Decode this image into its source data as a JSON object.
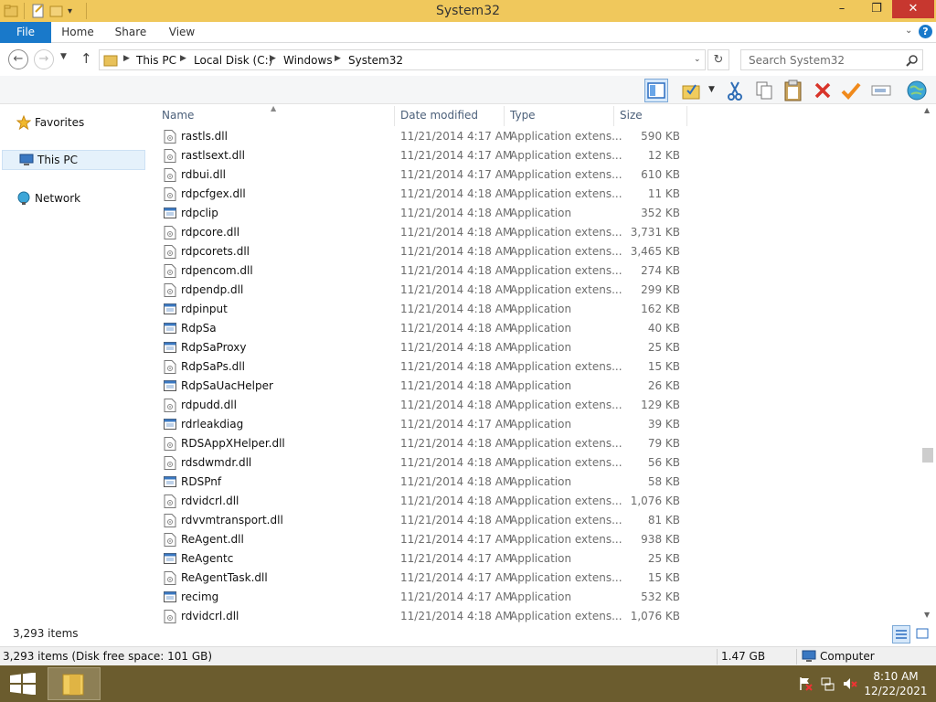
{
  "window": {
    "title": "System32",
    "minimize": "–",
    "maximize": "❐",
    "close": "✕"
  },
  "ribbon": {
    "tabs": [
      "File",
      "Home",
      "Share",
      "View"
    ],
    "help": "?"
  },
  "address": {
    "crumbs": [
      "This PC",
      "Local Disk (C:)",
      "Windows",
      "System32"
    ],
    "search_placeholder": "Search System32"
  },
  "nav_pane": {
    "items": [
      "Favorites",
      "This PC",
      "Network"
    ]
  },
  "columns": {
    "name": "Name",
    "date": "Date modified",
    "type": "Type",
    "size": "Size"
  },
  "files": [
    {
      "name": "rastls.dll",
      "date": "11/21/2014 4:17 AM",
      "type": "Application extens...",
      "size": "590 KB",
      "kind": "dll"
    },
    {
      "name": "rastlsext.dll",
      "date": "11/21/2014 4:17 AM",
      "type": "Application extens...",
      "size": "12 KB",
      "kind": "dll"
    },
    {
      "name": "rdbui.dll",
      "date": "11/21/2014 4:17 AM",
      "type": "Application extens...",
      "size": "610 KB",
      "kind": "dll"
    },
    {
      "name": "rdpcfgex.dll",
      "date": "11/21/2014 4:18 AM",
      "type": "Application extens...",
      "size": "11 KB",
      "kind": "dll"
    },
    {
      "name": "rdpclip",
      "date": "11/21/2014 4:18 AM",
      "type": "Application",
      "size": "352 KB",
      "kind": "exe"
    },
    {
      "name": "rdpcore.dll",
      "date": "11/21/2014 4:18 AM",
      "type": "Application extens...",
      "size": "3,731 KB",
      "kind": "dll"
    },
    {
      "name": "rdpcorets.dll",
      "date": "11/21/2014 4:18 AM",
      "type": "Application extens...",
      "size": "3,465 KB",
      "kind": "dll"
    },
    {
      "name": "rdpencom.dll",
      "date": "11/21/2014 4:18 AM",
      "type": "Application extens...",
      "size": "274 KB",
      "kind": "dll"
    },
    {
      "name": "rdpendp.dll",
      "date": "11/21/2014 4:18 AM",
      "type": "Application extens...",
      "size": "299 KB",
      "kind": "dll"
    },
    {
      "name": "rdpinput",
      "date": "11/21/2014 4:18 AM",
      "type": "Application",
      "size": "162 KB",
      "kind": "exe"
    },
    {
      "name": "RdpSa",
      "date": "11/21/2014 4:18 AM",
      "type": "Application",
      "size": "40 KB",
      "kind": "exe"
    },
    {
      "name": "RdpSaProxy",
      "date": "11/21/2014 4:18 AM",
      "type": "Application",
      "size": "25 KB",
      "kind": "exe"
    },
    {
      "name": "RdpSaPs.dll",
      "date": "11/21/2014 4:18 AM",
      "type": "Application extens...",
      "size": "15 KB",
      "kind": "dll"
    },
    {
      "name": "RdpSaUacHelper",
      "date": "11/21/2014 4:18 AM",
      "type": "Application",
      "size": "26 KB",
      "kind": "exe"
    },
    {
      "name": "rdpudd.dll",
      "date": "11/21/2014 4:18 AM",
      "type": "Application extens...",
      "size": "129 KB",
      "kind": "dll"
    },
    {
      "name": "rdrleakdiag",
      "date": "11/21/2014 4:17 AM",
      "type": "Application",
      "size": "39 KB",
      "kind": "exe"
    },
    {
      "name": "RDSAppXHelper.dll",
      "date": "11/21/2014 4:18 AM",
      "type": "Application extens...",
      "size": "79 KB",
      "kind": "dll"
    },
    {
      "name": "rdsdwmdr.dll",
      "date": "11/21/2014 4:18 AM",
      "type": "Application extens...",
      "size": "56 KB",
      "kind": "dll"
    },
    {
      "name": "RDSPnf",
      "date": "11/21/2014 4:18 AM",
      "type": "Application",
      "size": "58 KB",
      "kind": "exe"
    },
    {
      "name": "rdvidcrl.dll",
      "date": "11/21/2014 4:18 AM",
      "type": "Application extens...",
      "size": "1,076 KB",
      "kind": "dll"
    },
    {
      "name": "rdvvmtransport.dll",
      "date": "11/21/2014 4:18 AM",
      "type": "Application extens...",
      "size": "81 KB",
      "kind": "dll"
    },
    {
      "name": "ReAgent.dll",
      "date": "11/21/2014 4:17 AM",
      "type": "Application extens...",
      "size": "938 KB",
      "kind": "dll"
    },
    {
      "name": "ReAgentc",
      "date": "11/21/2014 4:17 AM",
      "type": "Application",
      "size": "25 KB",
      "kind": "exe"
    },
    {
      "name": "ReAgentTask.dll",
      "date": "11/21/2014 4:17 AM",
      "type": "Application extens...",
      "size": "15 KB",
      "kind": "dll"
    },
    {
      "name": "recimg",
      "date": "11/21/2014 4:17 AM",
      "type": "Application",
      "size": "532 KB",
      "kind": "exe"
    },
    {
      "name": "rdvidcrl.dll",
      "date": "11/21/2014 4:18 AM",
      "type": "Application extens...",
      "size": "1,076 KB",
      "kind": "dll"
    }
  ],
  "footer": {
    "item_count": "3,293 items"
  },
  "status": {
    "left": "3,293 items (Disk free space: 101 GB)",
    "mid": "1.47 GB",
    "right": "Computer"
  },
  "taskbar": {
    "time": "8:10 AM",
    "date": "12/22/2021"
  },
  "colors": {
    "titlebar": "#f0c85c",
    "file_tab": "#1979ca",
    "taskbar": "#6b5c2e",
    "close": "#c7372f"
  }
}
